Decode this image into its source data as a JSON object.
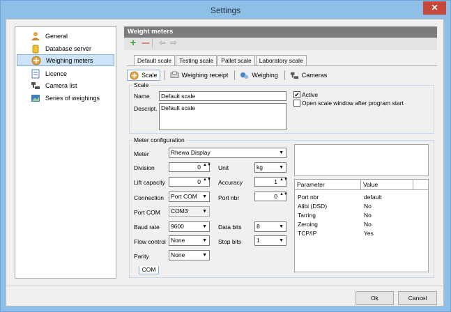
{
  "window": {
    "title": "Settings",
    "close_glyph": "✕"
  },
  "sidebar": {
    "items": [
      {
        "label": "General",
        "icon": "person-icon",
        "selected": false
      },
      {
        "label": "Database server",
        "icon": "database-icon",
        "selected": false
      },
      {
        "label": "Weighing meters",
        "icon": "scale-icon",
        "selected": true
      },
      {
        "label": "Licence",
        "icon": "document-icon",
        "selected": false
      },
      {
        "label": "Camera list",
        "icon": "camera-icon",
        "selected": false
      },
      {
        "label": "Series of weighings",
        "icon": "image-icon",
        "selected": false
      }
    ]
  },
  "main": {
    "header": "Weight meters",
    "toolbar": {
      "add_glyph": "+",
      "remove_glyph": "—",
      "prev_glyph": "⇦",
      "next_glyph": "⇨"
    },
    "tabs": [
      "Default scale",
      "Testing scale",
      "Pallet scale",
      "Laboratory scale"
    ],
    "active_tab": 0,
    "subtabs": [
      {
        "label": "Scale",
        "icon": "scale-icon"
      },
      {
        "label": "Weighing receipt",
        "icon": "receipt-icon"
      },
      {
        "label": "Weighing",
        "icon": "weighing-icon"
      },
      {
        "label": "Cameras",
        "icon": "camera-icon"
      }
    ],
    "scale_group": {
      "title": "Scale",
      "name_label": "Name",
      "name_value": "Default scale",
      "desc_label": "Descript.",
      "desc_value": "Default scale",
      "active_label": "Active",
      "active_checked": true,
      "open_label": "Open scale window after program start",
      "open_checked": false
    },
    "meter_group": {
      "title": "Meter configuration",
      "meter_label": "Meter",
      "meter_value": "Rhewa Display",
      "division_label": "Division",
      "division_value": "0",
      "unit_label": "Unit",
      "unit_value": "kg",
      "lift_label": "Lift capacity",
      "lift_value": "0",
      "accuracy_label": "Accuracy",
      "accuracy_value": "1",
      "connection_label": "Connection",
      "connection_value": "Port COM",
      "portnbr_label": "Port nbr",
      "portnbr_value": "0",
      "portcom_label": "Port COM",
      "portcom_value": "COM3",
      "baud_label": "Baud rate",
      "baud_value": "9600",
      "databits_label": "Data bits",
      "databits_value": "8",
      "flow_label": "Flow control",
      "flow_value": "None",
      "stopbits_label": "Stop bits",
      "stopbits_value": "1",
      "parity_label": "Parity",
      "parity_value": "None",
      "com_tab": "COM",
      "arrow": "▼",
      "spin_glyph": "▲▼",
      "check_glyph": "✔"
    },
    "param_grid": {
      "headers": [
        "Parameter",
        "Value"
      ],
      "rows": [
        [
          "Port nbr",
          "default"
        ],
        [
          "Alibi (DSD)",
          "No"
        ],
        [
          "Tarring",
          "No"
        ],
        [
          "Zeroing",
          "No"
        ],
        [
          "TCP/IP",
          "Yes"
        ]
      ]
    }
  },
  "footer": {
    "ok": "Ok",
    "cancel": "Cancel"
  },
  "colors": {
    "titlebar": "#8fbfe7",
    "close": "#c7473a",
    "header": "#7b7b7b",
    "selection": "#cde3f7",
    "add": "#3ca63c",
    "remove": "#d23c3c"
  }
}
